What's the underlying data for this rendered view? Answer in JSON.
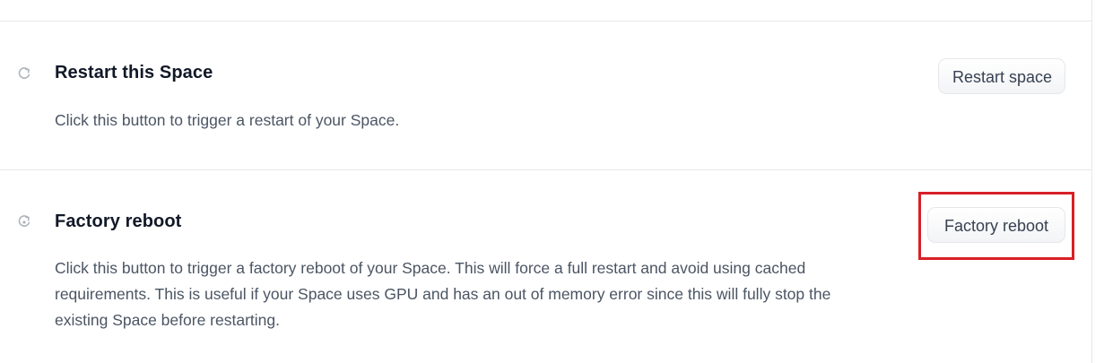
{
  "restart": {
    "title": "Restart this Space",
    "description": "Click this button to trigger a restart of your Space.",
    "button_label": "Restart space",
    "icon": "restart-icon"
  },
  "factory": {
    "title": "Factory reboot",
    "description": "Click this button to trigger a factory reboot of your Space. This will force a full restart and avoid using cached requirements. This is useful if your Space uses GPU and has an out of memory error since this will fully stop the existing Space before restarting.",
    "button_label": "Factory reboot",
    "icon": "factory-reboot-icon"
  },
  "colors": {
    "highlight": "#d91f26",
    "title_text": "#111827",
    "body_text": "#4b5563",
    "border": "#e6e8eb"
  }
}
